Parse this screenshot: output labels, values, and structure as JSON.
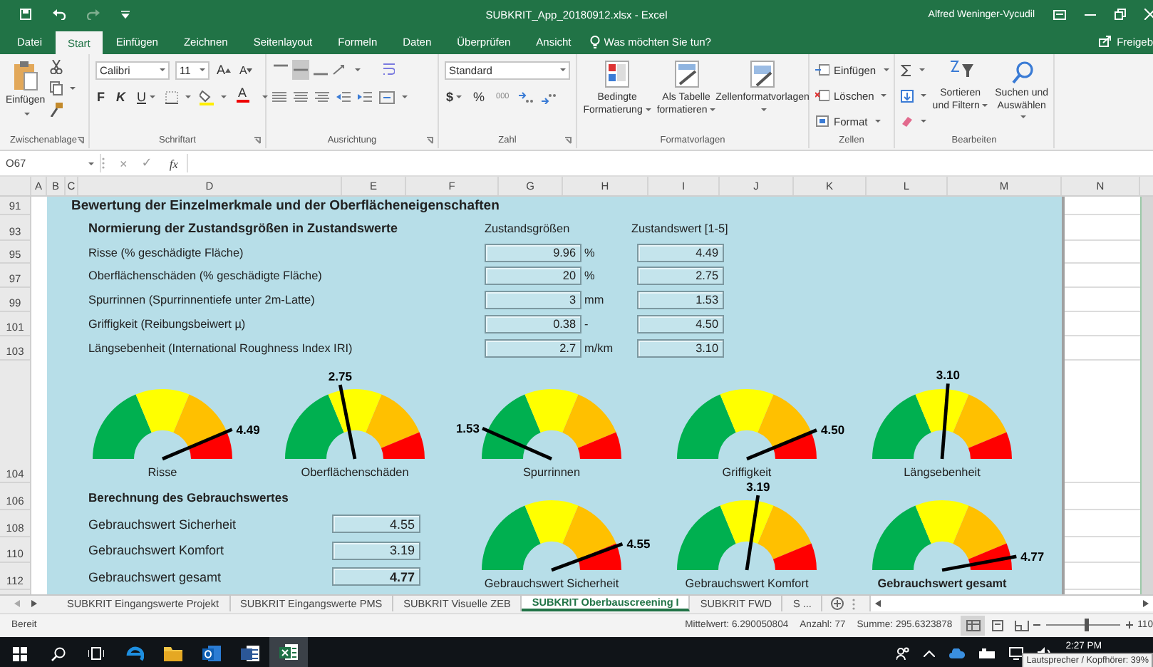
{
  "window": {
    "title": "SUBKRIT_App_20180912.xlsx - Excel",
    "user": "Alfred Weninger-Vycudil"
  },
  "ribbon_tabs": [
    {
      "label": "Datei",
      "selected": false
    },
    {
      "label": "Start",
      "selected": true
    },
    {
      "label": "Einfügen",
      "selected": false
    },
    {
      "label": "Zeichnen",
      "selected": false
    },
    {
      "label": "Seitenlayout",
      "selected": false
    },
    {
      "label": "Formeln",
      "selected": false
    },
    {
      "label": "Daten",
      "selected": false
    },
    {
      "label": "Überprüfen",
      "selected": false
    },
    {
      "label": "Ansicht",
      "selected": false
    }
  ],
  "tell_me": {
    "placeholder": "Was möchten Sie tun?"
  },
  "share": "Freigeb",
  "ribbon": {
    "clipboard": {
      "paste": "Einfügen",
      "label": "Zwischenablage"
    },
    "font": {
      "name": "Calibri",
      "size": "11",
      "grow": "A",
      "shrink": "A",
      "bold": "F",
      "italic": "K",
      "underline": "U",
      "color_button": "A",
      "label": "Schriftart"
    },
    "alignment": {
      "vertical": [
        {
          "selected": false
        },
        {
          "selected": true
        },
        {
          "selected": false
        }
      ],
      "label": "Ausrichtung"
    },
    "number": {
      "format": "Standard",
      "currency": "$",
      "percent": "%",
      "thousands": "000",
      "label": "Zahl"
    },
    "styles": {
      "buttons": [
        "Bedingte Formatierung",
        "Als Tabelle formatieren",
        "Zellenformatvorlagen"
      ],
      "label": "Formatvorlagen"
    },
    "cells": {
      "buttons": [
        "Einfügen",
        "Löschen",
        "Format"
      ],
      "label": "Zellen"
    },
    "editing": {
      "buttons": [
        "Sortieren und Filtern",
        "Suchen und Auswählen"
      ],
      "label": "Bearbeiten"
    }
  },
  "formula_bar": {
    "name_box": "O67",
    "cancel": "×",
    "enter": "✓",
    "function": "fx"
  },
  "columns": [
    "A",
    "B",
    "C",
    "D",
    "E",
    "F",
    "G",
    "H",
    "I",
    "J",
    "K",
    "L",
    "M",
    "N"
  ],
  "rows": [
    "91",
    "93",
    "95",
    "97",
    "99",
    "101",
    "103",
    "104",
    "106",
    "108",
    "110",
    "112"
  ],
  "sheet": {
    "title": "Bewertung der Einzelmerkmale und der Oberflächeneigenschaften",
    "norm_heading": "Normierung der Zustandsgrößen in Zustandswerte",
    "col_quantity": "Zustandsgrößen",
    "col_value": "Zustandswert [1-5]",
    "criteria": [
      {
        "label": "Risse (% geschädigte Fläche)",
        "quantity": "9.96",
        "unit": "%",
        "value": "4.49"
      },
      {
        "label": "Oberflächenschäden (% geschädigte Fläche)",
        "quantity": "20",
        "unit": "%",
        "value": "2.75"
      },
      {
        "label": "Spurrinnen (Spurrinnentiefe unter 2m-Latte)",
        "quantity": "3",
        "unit": "mm",
        "value": "1.53"
      },
      {
        "label": "Griffigkeit (Reibungsbeiwert µ)",
        "quantity": "0.38",
        "unit": "-",
        "value": "4.50"
      },
      {
        "label": "Längsebenheit (International Roughness Index IRI)",
        "quantity": "2.7",
        "unit": "m/km",
        "value": "3.10"
      }
    ],
    "gauges": [
      {
        "name": "Risse",
        "reading": "4.49"
      },
      {
        "name": "Oberflächenschäden",
        "reading": "2.75"
      },
      {
        "name": "Spurrinnen",
        "reading": "1.53"
      },
      {
        "name": "Griffigkeit",
        "reading": "4.50"
      },
      {
        "name": "Längsebenheit",
        "reading": "3.10"
      }
    ],
    "usage_heading": "Berechnung des Gebrauchswertes",
    "usage": [
      {
        "label": "Gebrauchswert Sicherheit",
        "value": "4.55",
        "emphasis": false
      },
      {
        "label": "Gebrauchswert Komfort",
        "value": "3.19",
        "emphasis": false
      },
      {
        "label": "Gebrauchswert gesamt",
        "value": "4.77",
        "emphasis": true
      }
    ],
    "usage_gauges": [
      {
        "name": "Gebrauchswert Sicherheit",
        "reading": "4.55",
        "emphasis": false
      },
      {
        "name": "Gebrauchswert Komfort",
        "reading": "3.19",
        "emphasis": false
      },
      {
        "name": "Gebrauchswert gesamt",
        "reading": "4.77",
        "emphasis": true
      }
    ]
  },
  "sheet_tabs": [
    {
      "label": "SUBKRIT Eingangswerte Projekt",
      "selected": false
    },
    {
      "label": "SUBKRIT Eingangswerte PMS",
      "selected": false
    },
    {
      "label": "SUBKRIT Visuelle ZEB",
      "selected": false
    },
    {
      "label": "SUBKRIT Oberbauscreening I",
      "selected": true
    },
    {
      "label": "SUBKRIT FWD",
      "selected": false
    },
    {
      "label": "S ...",
      "selected": false
    }
  ],
  "status_bar": {
    "ready": "Bereit",
    "average": "Mittelwert: 6.290050804",
    "count": "Anzahl: 77",
    "sum": "Summe: 295.6323878",
    "views": [
      {
        "selected": true
      },
      {
        "selected": false
      },
      {
        "selected": false
      }
    ],
    "zoom": {
      "level": 0.53,
      "reading": "110"
    }
  },
  "taskbar": {
    "apps": [
      {
        "selected": false
      },
      {
        "selected": false
      },
      {
        "selected": false
      },
      {
        "selected": false
      },
      {
        "selected": true
      }
    ],
    "time": "2:27 PM",
    "tooltip": "Lautsprecher / Kopfhörer: 39%"
  }
}
